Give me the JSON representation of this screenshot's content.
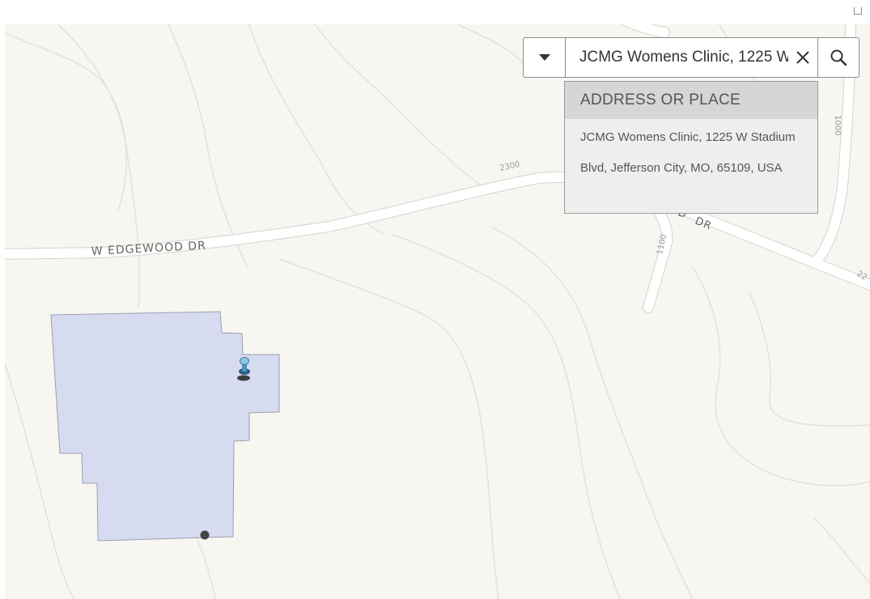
{
  "search": {
    "value": "JCMG Womens Clinic, 1225 W Stadium Blvd, Jefferson City, MO, 65109, USA",
    "clear_icon": "close-icon",
    "search_icon": "search-icon",
    "source_icon": "caret-down-icon"
  },
  "suggestions": {
    "header": "ADDRESS OR PLACE",
    "items": [
      {
        "label": "JCMG Womens Clinic, 1225 W Stadium Blvd, Jefferson City, MO, 65109, USA"
      }
    ]
  },
  "map": {
    "road_labels": {
      "edgewood": "W EDGEWOOD DR",
      "dr": "DR",
      "dr_partial": "D"
    },
    "address_labels": {
      "a2300": "2300",
      "a1100": "1100",
      "a1000": "1000",
      "a22": "22"
    },
    "colors": {
      "background": "#f7f6f1",
      "parcel_fill": "#d7dbf0",
      "contour": "#e2e1da",
      "road": "#ffffff",
      "pin": "#5fa8d3"
    }
  }
}
